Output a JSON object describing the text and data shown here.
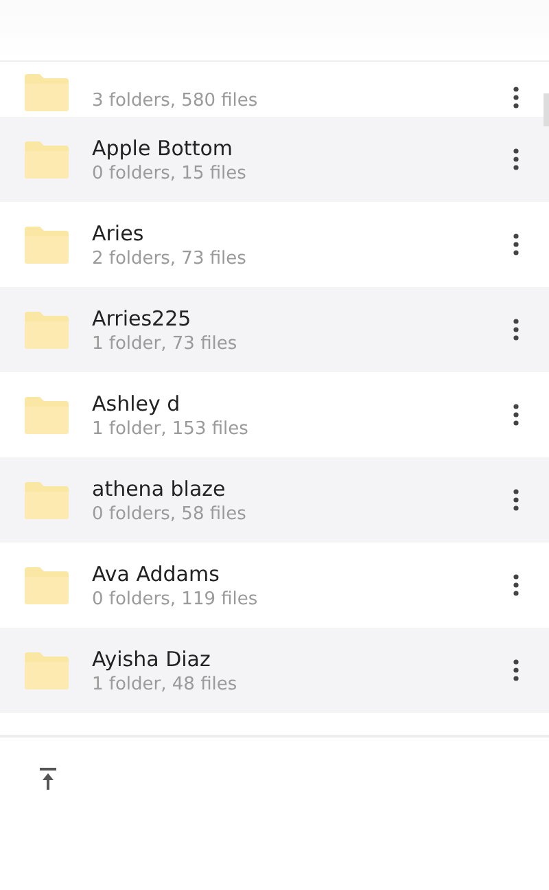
{
  "folders": [
    {
      "summary": "3 folders, 580 files"
    },
    {
      "name": "Apple Bottom",
      "summary": "0 folders, 15 files"
    },
    {
      "name": "Aries",
      "summary": "2 folders, 73 files"
    },
    {
      "name": "Arries225",
      "summary": "1 folder, 73 files"
    },
    {
      "name": "Ashley d",
      "summary": "1 folder, 153 files"
    },
    {
      "name": "athena blaze",
      "summary": "0 folders, 58 files"
    },
    {
      "name": "Ava Addams",
      "summary": "0 folders, 119 files"
    },
    {
      "name": "Ayisha Diaz",
      "summary": "1 folder, 48 files"
    }
  ]
}
